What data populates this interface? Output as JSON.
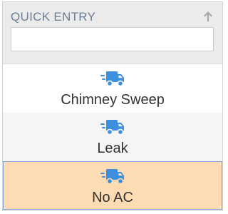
{
  "header": {
    "title": "QUICK ENTRY",
    "search_value": "",
    "search_placeholder": ""
  },
  "items": [
    {
      "label": "Chimney Sweep",
      "icon": "truck-icon",
      "selected": false
    },
    {
      "label": "Leak",
      "icon": "truck-icon",
      "selected": false
    },
    {
      "label": "No AC",
      "icon": "truck-icon",
      "selected": true
    }
  ],
  "colors": {
    "icon": "#3d8fe0",
    "title": "#6d7f95",
    "selected_bg": "#fddcb4",
    "selected_border": "#7fa2d6"
  }
}
